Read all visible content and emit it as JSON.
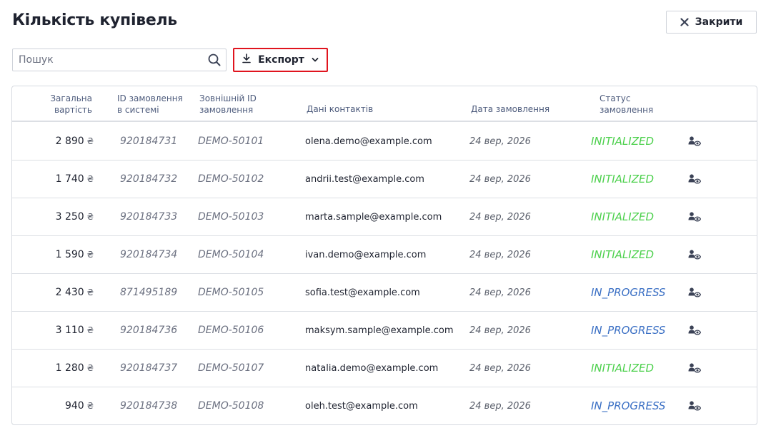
{
  "header": {
    "title": "Кількість купівель",
    "close_label": "Закрити"
  },
  "toolbar": {
    "search_placeholder": "Пошук",
    "search_value": "",
    "export_label": "Експорт"
  },
  "table": {
    "columns": {
      "total_line1": "Загальна",
      "total_line2": "вартість",
      "id_line1": "ID замовлення",
      "id_line2": "в системі",
      "ext_line1": "Зовнішній ID",
      "ext_line2": "замовлення",
      "contact": "Дані контактів",
      "date": "Дата замовлення",
      "status_line1": "Статус",
      "status_line2": "замовлення"
    },
    "currency": "₴",
    "rows": [
      {
        "total": "2 890",
        "order_id": "920184731",
        "external_id": "DEMO-50101",
        "contact": "olena.demo@example.com",
        "date": "24 вер, 2026",
        "status": "INITIALIZED"
      },
      {
        "total": "1 740",
        "order_id": "920184732",
        "external_id": "DEMO-50102",
        "contact": "andrii.test@example.com",
        "date": "24 вер, 2026",
        "status": "INITIALIZED"
      },
      {
        "total": "3 250",
        "order_id": "920184733",
        "external_id": "DEMO-50103",
        "contact": "marta.sample@example.com",
        "date": "24 вер, 2026",
        "status": "INITIALIZED"
      },
      {
        "total": "1 590",
        "order_id": "920184734",
        "external_id": "DEMO-50104",
        "contact": "ivan.demo@example.com",
        "date": "24 вер, 2026",
        "status": "INITIALIZED"
      },
      {
        "total": "2 430",
        "order_id": "871495189",
        "external_id": "DEMO-50105",
        "contact": "sofia.test@example.com",
        "date": "24 вер, 2026",
        "status": "IN_PROGRESS"
      },
      {
        "total": "3 110",
        "order_id": "920184736",
        "external_id": "DEMO-50106",
        "contact": "maksym.sample@example.com",
        "date": "24 вер, 2026",
        "status": "IN_PROGRESS"
      },
      {
        "total": "1 280",
        "order_id": "920184737",
        "external_id": "DEMO-50107",
        "contact": "natalia.demo@example.com",
        "date": "24 вер, 2026",
        "status": "INITIALIZED"
      },
      {
        "total": "940",
        "order_id": "920184738",
        "external_id": "DEMO-50108",
        "contact": "oleh.test@example.com",
        "date": "24 вер, 2026",
        "status": "IN_PROGRESS"
      }
    ]
  },
  "colors": {
    "status_initialized": "#4cd04c",
    "status_in_progress": "#3a6fc4",
    "export_highlight": "#e0141e",
    "header_text": "#4d5b7c"
  },
  "icons": {
    "close": "close-icon",
    "search": "search-icon",
    "download": "download-icon",
    "dropdown": "chevron-down-icon",
    "row_action": "user-view-icon"
  }
}
